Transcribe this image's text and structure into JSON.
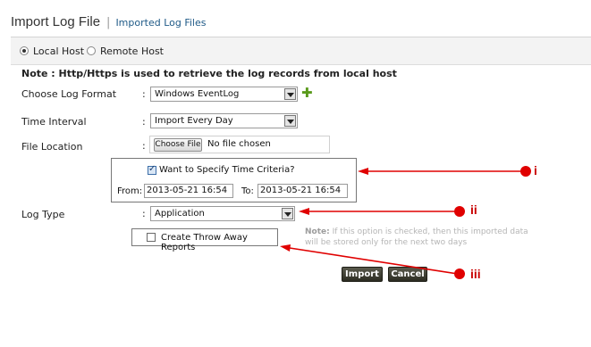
{
  "header": {
    "title": "Import Log File",
    "separator": "|",
    "link": "Imported Log Files"
  },
  "host": {
    "local_label": "Local Host",
    "remote_label": "Remote Host",
    "selected": "local"
  },
  "note": "Note : Http/Https is used to retrieve the log records from local host",
  "form": {
    "colon": ":",
    "log_format": {
      "label": "Choose Log Format",
      "value": "Windows EventLog"
    },
    "time_interval": {
      "label": "Time Interval",
      "value": "Import Every Day"
    },
    "file_location": {
      "label": "File Location",
      "button": "Choose File",
      "status": "No file chosen"
    },
    "time_criteria": {
      "checkbox_label": "Want to Specify Time Criteria?",
      "checked": true,
      "from_label": "From:",
      "from_value": "2013-05-21 16:54",
      "to_label": "To:",
      "to_value": "2013-05-21 16:54"
    },
    "log_type": {
      "label": "Log Type",
      "value": "Application"
    },
    "hint": {
      "prefix": "Note:",
      "text": "If this option is checked, then this imported data will be stored only for the next two days"
    },
    "throw_away": {
      "label": "Create Throw Away Reports",
      "checked": false
    }
  },
  "buttons": {
    "import": "Import",
    "cancel": "Cancel"
  },
  "annotations": [
    "i",
    "ii",
    "iii"
  ],
  "colors": {
    "annotation": "#e00000",
    "link": "#1f5a87",
    "add_icon": "#5a9a1c"
  }
}
